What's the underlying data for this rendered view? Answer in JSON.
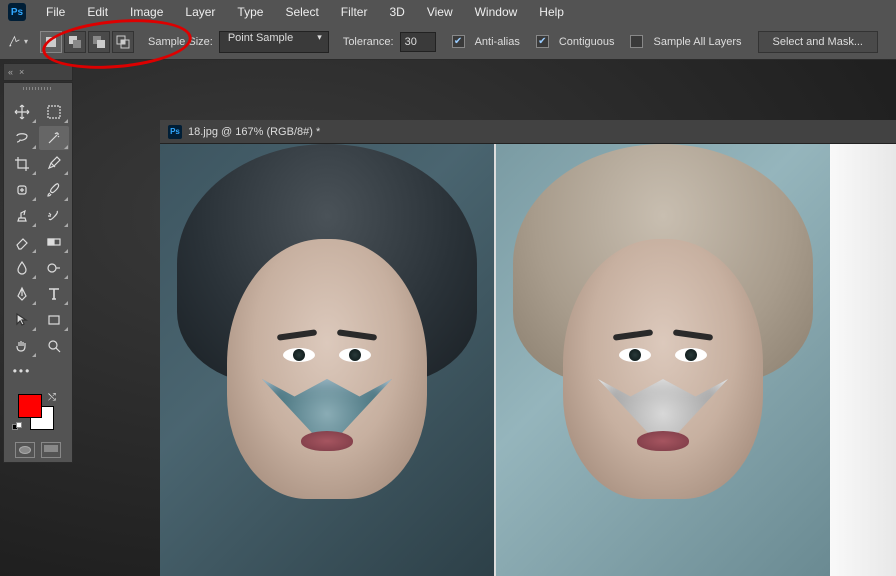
{
  "app": {
    "logo_text": "Ps"
  },
  "menu": [
    "File",
    "Edit",
    "Image",
    "Layer",
    "Type",
    "Select",
    "Filter",
    "3D",
    "View",
    "Window",
    "Help"
  ],
  "options": {
    "sample_size_label": "Sample Size:",
    "sample_size_value": "Point Sample",
    "tolerance_label": "Tolerance:",
    "tolerance_value": "30",
    "anti_alias_label": "Anti-alias",
    "anti_alias_checked": true,
    "contiguous_label": "Contiguous",
    "contiguous_checked": true,
    "sample_all_label": "Sample All Layers",
    "sample_all_checked": false,
    "select_mask_label": "Select and Mask..."
  },
  "document": {
    "title": "18.jpg @ 167% (RGB/8#) *",
    "file_icon_text": "Ps"
  },
  "swatches": {
    "foreground": "#ff0000",
    "background": "#ffffff"
  },
  "panel_collapse": {
    "left": "«",
    "close": "×"
  },
  "tools": {
    "row0": [
      "move-tool",
      "artboard-tool"
    ],
    "row1": [
      "lasso-tool",
      "magic-wand-tool"
    ],
    "row2": [
      "crop-tool",
      "eyedropper-tool"
    ],
    "row3": [
      "spot-heal-tool",
      "brush-tool"
    ],
    "row4": [
      "clone-stamp-tool",
      "history-brush-tool"
    ],
    "row5": [
      "eraser-tool",
      "gradient-tool"
    ],
    "row6": [
      "blur-tool",
      "dodge-tool"
    ],
    "row7": [
      "pen-tool",
      "type-tool"
    ],
    "row8": [
      "path-select-tool",
      "rectangle-shape-tool"
    ],
    "row9": [
      "hand-tool",
      "zoom-tool"
    ],
    "more": "•••"
  }
}
